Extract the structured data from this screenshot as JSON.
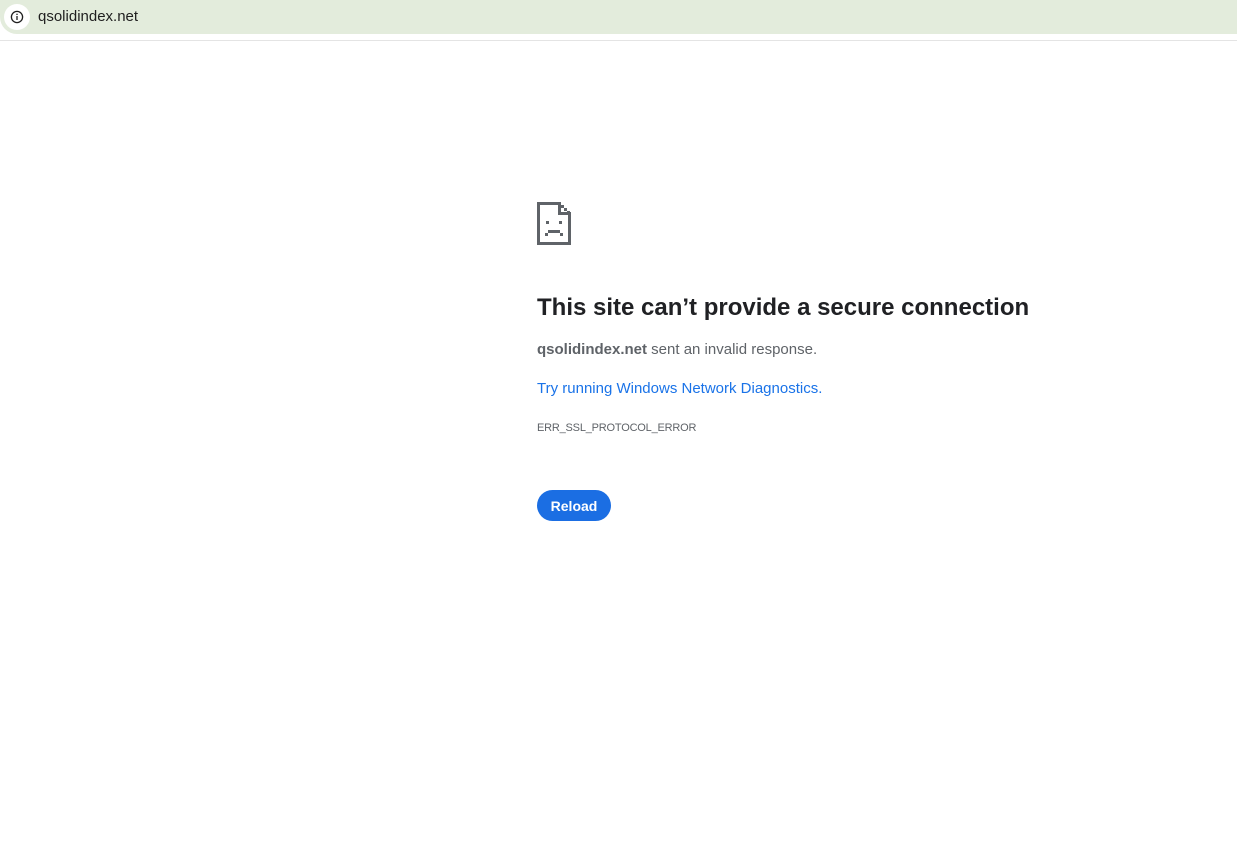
{
  "address_bar": {
    "url": "qsolidindex.net",
    "info_icon": "info-icon"
  },
  "error_page": {
    "icon": "sad-document-icon",
    "headline": "This site can’t provide a secure connection",
    "summary_host": "qsolidindex.net",
    "summary_rest": " sent an invalid response.",
    "diagnostics_link": "Try running Windows Network Diagnostics.",
    "error_code": "ERR_SSL_PROTOCOL_ERROR",
    "reload_label": "Reload"
  },
  "colors": {
    "address_bar_bg": "#e3ecdc",
    "headline": "#202124",
    "body_text": "#5f6368",
    "link": "#1a73e8",
    "button_bg": "#1b6ee3",
    "button_text": "#ffffff"
  }
}
